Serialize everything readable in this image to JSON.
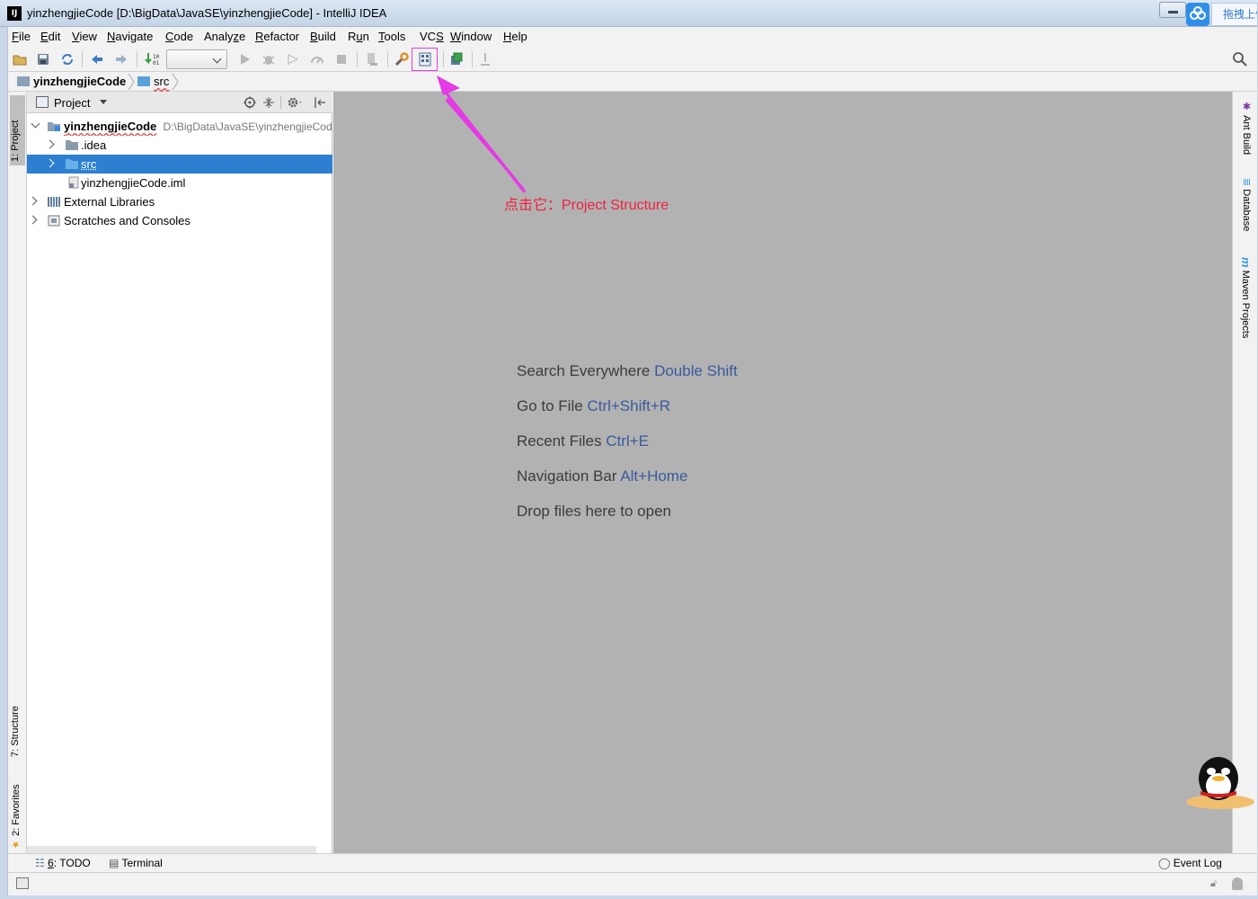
{
  "window": {
    "app_icon_text": "IJ",
    "title": "yinzhengjieCode [D:\\BigData\\JavaSE\\yinzhengjieCode] - IntelliJ IDEA",
    "drag_upload_label": "拖拽上传"
  },
  "menu": [
    {
      "mnemonic": "F",
      "rest": "ile"
    },
    {
      "mnemonic": "E",
      "rest": "dit"
    },
    {
      "mnemonic": "V",
      "rest": "iew"
    },
    {
      "mnemonic": "N",
      "rest": "avigate"
    },
    {
      "mnemonic": "C",
      "rest": "ode"
    },
    {
      "pre": "Analy",
      "mnemonic": "z",
      "rest": "e"
    },
    {
      "mnemonic": "R",
      "rest": "efactor"
    },
    {
      "mnemonic": "B",
      "rest": "uild"
    },
    {
      "pre": "R",
      "mnemonic": "u",
      "rest": "n"
    },
    {
      "mnemonic": "T",
      "rest": "ools"
    },
    {
      "pre": "VC",
      "mnemonic": "S",
      "rest": ""
    },
    {
      "mnemonic": "W",
      "rest": "indow"
    },
    {
      "mnemonic": "H",
      "rest": "elp"
    }
  ],
  "navbar": {
    "project": "yinzhengjieCode",
    "folder": "src"
  },
  "left_strip": {
    "project_tab": "1: Project",
    "structure_tab": "7: Structure",
    "favorites_tab": "2: Favorites"
  },
  "project_panel": {
    "title": "Project",
    "tree": [
      {
        "name": "yinzhengjieCode",
        "path": "D:\\BigData\\JavaSE\\yinzhengjieCode",
        "expanded": true
      },
      {
        "name": ".idea"
      },
      {
        "name": "src",
        "selected": true
      },
      {
        "name": "yinzhengjieCode.iml"
      },
      {
        "name": "External Libraries"
      },
      {
        "name": "Scratches and Consoles"
      }
    ]
  },
  "editor_hints": [
    {
      "text": "Search Everywhere",
      "key": "Double Shift"
    },
    {
      "text": "Go to File",
      "key": "Ctrl+Shift+R"
    },
    {
      "text": "Recent Files",
      "key": "Ctrl+E"
    },
    {
      "text": "Navigation Bar",
      "key": "Alt+Home"
    },
    {
      "text": "Drop files here to open",
      "key": ""
    }
  ],
  "annotation": {
    "text": "点击它：Project Structure",
    "color": "#f02040",
    "arrow_color": "#e53ae5"
  },
  "right_strip": {
    "ant_build": "Ant Build",
    "database": "Database",
    "maven": "Maven Projects"
  },
  "bottom_bar": {
    "todo_mnemonic": "6",
    "todo_rest": ": TODO",
    "terminal": "Terminal",
    "event_log": "Event Log"
  },
  "colors": {
    "selection": "#2c7fd1",
    "editor_bg": "#b2b2b2",
    "hint_key": "#3a5a9c"
  }
}
